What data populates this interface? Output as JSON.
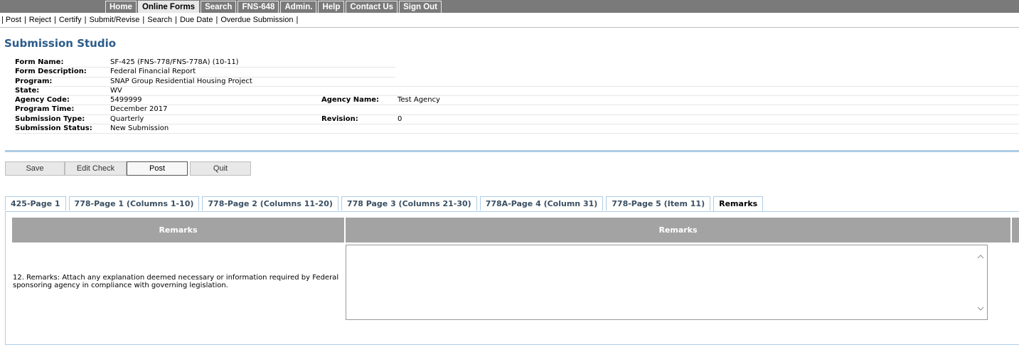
{
  "topnav": {
    "items": [
      {
        "label": "Home"
      },
      {
        "label": "Online Forms",
        "active": true
      },
      {
        "label": "Search"
      },
      {
        "label": "FNS-648"
      },
      {
        "label": "Admin."
      },
      {
        "label": "Help"
      },
      {
        "label": "Contact Us"
      },
      {
        "label": "Sign Out"
      }
    ]
  },
  "subnav": {
    "items": [
      "Post",
      "Reject",
      "Certify",
      "Submit/Revise",
      "Search",
      "Due Date",
      "Overdue Submission"
    ],
    "separator": "|"
  },
  "page": {
    "title": "Submission Studio"
  },
  "form_info": {
    "form_name_label": "Form Name:",
    "form_name": "SF-425 (FNS-778/FNS-778A) (10-11)",
    "form_description_label": "Form Description:",
    "form_description": "Federal Financial Report",
    "program_label": "Program:",
    "program": "SNAP Group Residential Housing Project",
    "state_label": "State:",
    "state": "WV",
    "agency_code_label": "Agency Code:",
    "agency_code": "5499999",
    "agency_name_label": "Agency Name:",
    "agency_name": "Test Agency",
    "program_time_label": "Program Time:",
    "program_time": "December 2017",
    "submission_type_label": "Submission Type:",
    "submission_type": "Quarterly",
    "revision_label": "Revision:",
    "revision": "0",
    "submission_status_label": "Submission Status:",
    "submission_status": "New Submission"
  },
  "actions": {
    "save": "Save",
    "edit_check": "Edit Check",
    "post": "Post",
    "quit": "Quit"
  },
  "tabs": [
    {
      "label": "425-Page 1"
    },
    {
      "label": "778-Page 1 (Columns 1-10)"
    },
    {
      "label": "778-Page 2 (Columns 11-20)"
    },
    {
      "label": "778 Page 3 (Columns 21-30)"
    },
    {
      "label": "778A-Page 4 (Column 31)"
    },
    {
      "label": "778-Page 5 (Item 11)"
    },
    {
      "label": "Remarks",
      "active": true
    }
  ],
  "remarks_panel": {
    "col1_header": "Remarks",
    "col2_header": "Remarks",
    "description": "12. Remarks: Attach any explanation deemed necessary or information required by Federal sponsoring agency in compliance with governing legislation.",
    "value": "",
    "scroll_up_icon": "chevron-up-icon",
    "scroll_down_icon": "chevron-down-icon"
  }
}
